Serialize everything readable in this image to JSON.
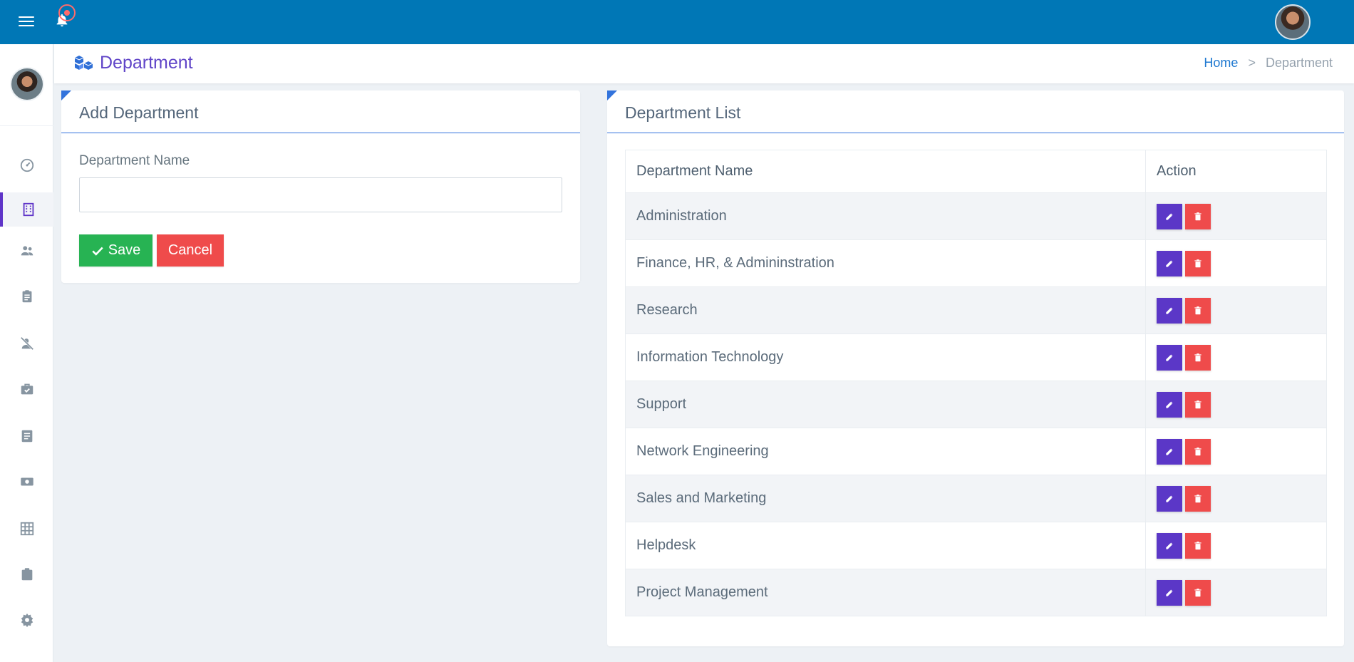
{
  "header": {
    "page_title": "Department",
    "breadcrumb": {
      "home": "Home",
      "separator": ">",
      "current": "Department"
    }
  },
  "topbar": {
    "menu_icon": "hamburger-icon",
    "notification_icon": "bell-icon",
    "background": "#0077b6"
  },
  "sidebar": {
    "items": [
      {
        "name": "dashboard",
        "icon": "dashboard-icon",
        "active": false
      },
      {
        "name": "department",
        "icon": "building-icon",
        "active": true
      },
      {
        "name": "employees",
        "icon": "users-icon",
        "active": false
      },
      {
        "name": "attendance",
        "icon": "clipboard-icon",
        "active": false
      },
      {
        "name": "leave",
        "icon": "user-off-icon",
        "active": false
      },
      {
        "name": "tasks",
        "icon": "briefcase-check-icon",
        "active": false
      },
      {
        "name": "notes",
        "icon": "document-icon",
        "active": false
      },
      {
        "name": "payroll",
        "icon": "cash-icon",
        "active": false
      },
      {
        "name": "grid",
        "icon": "grid-icon",
        "active": false
      },
      {
        "name": "jobs",
        "icon": "clipboard-filled-icon",
        "active": false
      },
      {
        "name": "settings",
        "icon": "gear-icon",
        "active": false
      }
    ]
  },
  "add_form": {
    "title": "Add Department",
    "field_label": "Department Name",
    "field_value": "",
    "save_label": "Save",
    "cancel_label": "Cancel"
  },
  "list": {
    "title": "Department List",
    "columns": [
      "Department Name",
      "Action"
    ],
    "rows": [
      "Administration",
      "Finance, HR, & Admininstration",
      "Research",
      "Information Technology",
      "Support",
      "Network Engineering",
      "Sales and Marketing",
      "Helpdesk",
      "Project Management"
    ]
  },
  "colors": {
    "accent": "#6045c8",
    "save": "#27b353",
    "cancel": "#ef4b4b",
    "edit": "#5b37c7"
  }
}
